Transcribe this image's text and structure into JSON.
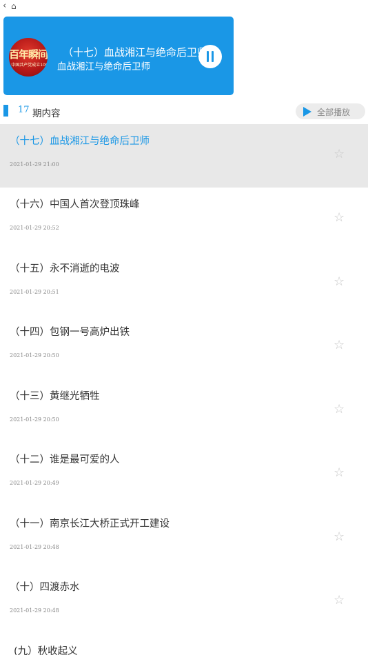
{
  "nav": {
    "back_icon": "‹",
    "home_icon": "⌂"
  },
  "player": {
    "cover_line1": "百年瞬间",
    "cover_line2": "中国共产党成立100",
    "title_main": "（十七）血战湘江与绝命后卫师",
    "title_sub": "血战湘江与绝命后卫师",
    "state": "playing",
    "accent_color": "#1a97e6"
  },
  "section": {
    "count": "17",
    "count_label": "期内容",
    "play_all_label": "全部播放"
  },
  "episodes": [
    {
      "title": "（十七）血战湘江与绝命后卫师",
      "date": "2021-01-29 21:00",
      "active": true
    },
    {
      "title": "（十六）中国人首次登顶珠峰",
      "date": "2021-01-29 20:52",
      "active": false
    },
    {
      "title": "（十五）永不消逝的电波",
      "date": "2021-01-29 20:51",
      "active": false
    },
    {
      "title": "（十四）包钢一号高炉出铁",
      "date": "2021-01-29 20:50",
      "active": false
    },
    {
      "title": "（十三）黄继光牺牲",
      "date": "2021-01-29 20:50",
      "active": false
    },
    {
      "title": "（十二）谁是最可爱的人",
      "date": "2021-01-29 20:49",
      "active": false
    },
    {
      "title": "（十一）南京长江大桥正式开工建设",
      "date": "2021-01-29 20:48",
      "active": false
    },
    {
      "title": "（十）四渡赤水",
      "date": "2021-01-29 20:48",
      "active": false
    },
    {
      "title": "(九）秋收起义",
      "date": "",
      "active": false
    }
  ],
  "icons": {
    "star": "☆"
  }
}
